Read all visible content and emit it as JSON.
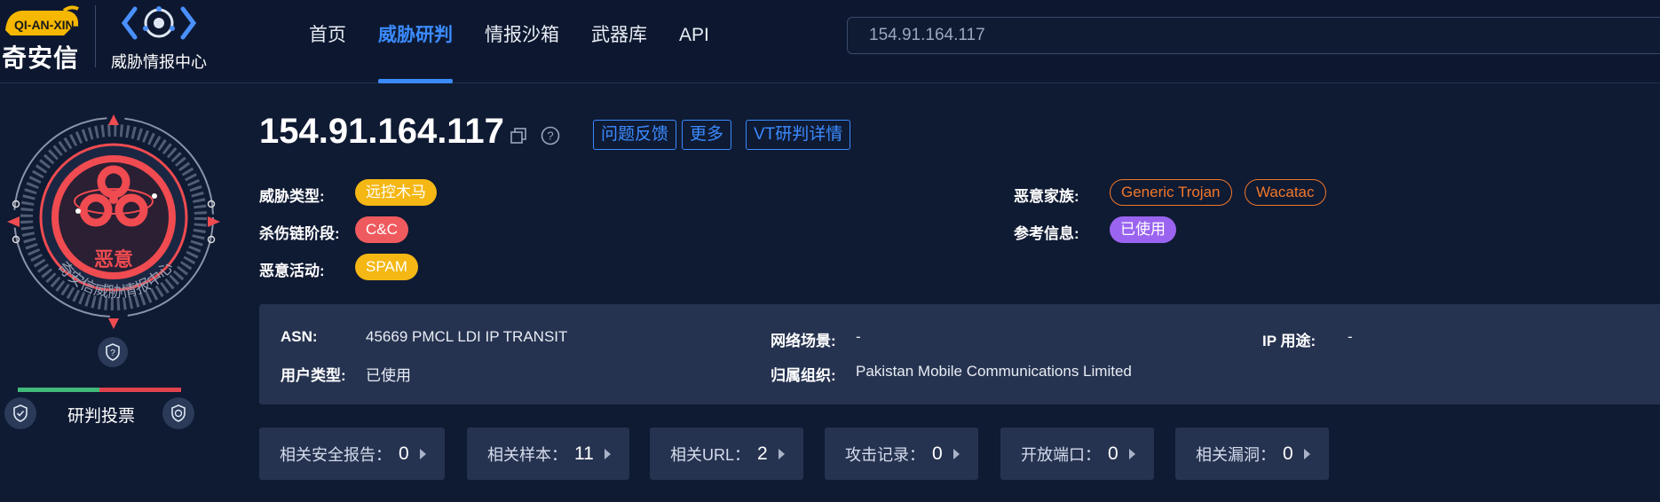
{
  "header": {
    "brand_name": "奇安信",
    "brand_logo_text": "QI-AN-XIN",
    "product_name": "威胁情报中心",
    "nav": [
      {
        "label": "首页",
        "active": false
      },
      {
        "label": "威胁研判",
        "active": true
      },
      {
        "label": "情报沙箱",
        "active": false
      },
      {
        "label": "武器库",
        "active": false
      },
      {
        "label": "API",
        "active": false
      }
    ],
    "search_value": "154.91.164.117"
  },
  "badge": {
    "verdict": "恶意",
    "ring_text": "奇安信威胁情报中心",
    "vote_label": "研判投票",
    "vote_safe_ratio": 0.5,
    "vote_malicious_ratio": 0.5,
    "colors": {
      "malicious": "#ef4b51",
      "safe": "#3fba7a"
    }
  },
  "title": {
    "ip": "154.91.164.117",
    "buttons": [
      "问题反馈",
      "更多",
      "VT研判详情"
    ]
  },
  "info": {
    "threat_type_label": "威胁类型:",
    "threat_type": "远控木马",
    "kill_chain_label": "杀伤链阶段:",
    "kill_chain": "C&C",
    "activity_label": "恶意活动:",
    "activity": "SPAM",
    "family_label": "恶意家族:",
    "families": [
      "Generic Trojan",
      "Wacatac"
    ],
    "reference_label": "参考信息:",
    "reference": "已使用"
  },
  "panel": {
    "asn_label": "ASN:",
    "asn_value": "45669 PMCL LDI IP TRANSIT",
    "user_type_label": "用户类型:",
    "user_type_value": "已使用",
    "network_label": "网络场景:",
    "network_value": "-",
    "org_label": "归属组织:",
    "org_value": "Pakistan Mobile Communications Limited",
    "ip_use_label": "IP 用途:",
    "ip_use_value": "-"
  },
  "stats": [
    {
      "label": "相关安全报告：",
      "value": "0"
    },
    {
      "label": "相关样本：",
      "value": "11"
    },
    {
      "label": "相关URL：",
      "value": "2"
    },
    {
      "label": "攻击记录：",
      "value": "0"
    },
    {
      "label": "开放端口：",
      "value": "0"
    },
    {
      "label": "相关漏洞：",
      "value": "0"
    }
  ]
}
